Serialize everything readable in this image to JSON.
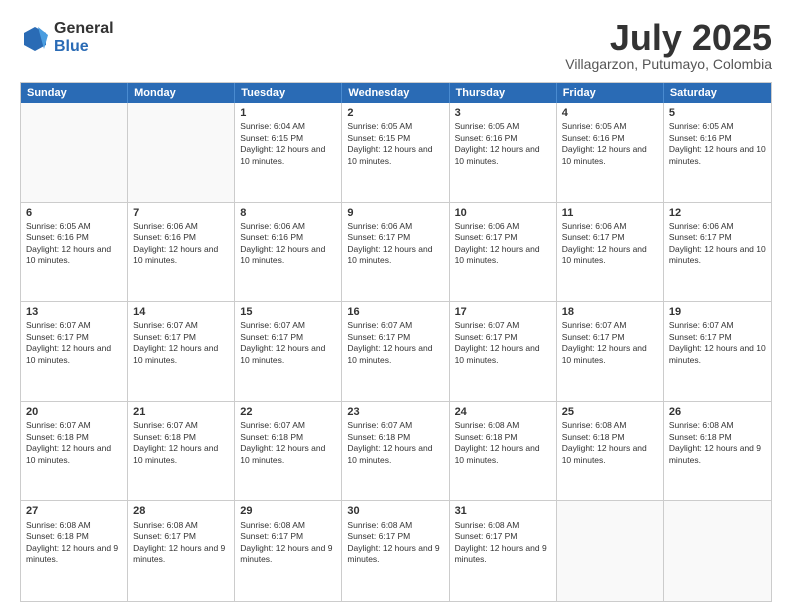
{
  "logo": {
    "general": "General",
    "blue": "Blue"
  },
  "title": {
    "month_year": "July 2025",
    "location": "Villagarzon, Putumayo, Colombia"
  },
  "weekdays": [
    "Sunday",
    "Monday",
    "Tuesday",
    "Wednesday",
    "Thursday",
    "Friday",
    "Saturday"
  ],
  "rows": [
    [
      {
        "day": "",
        "info": ""
      },
      {
        "day": "",
        "info": ""
      },
      {
        "day": "1",
        "info": "Sunrise: 6:04 AM\nSunset: 6:15 PM\nDaylight: 12 hours and 10 minutes."
      },
      {
        "day": "2",
        "info": "Sunrise: 6:05 AM\nSunset: 6:15 PM\nDaylight: 12 hours and 10 minutes."
      },
      {
        "day": "3",
        "info": "Sunrise: 6:05 AM\nSunset: 6:16 PM\nDaylight: 12 hours and 10 minutes."
      },
      {
        "day": "4",
        "info": "Sunrise: 6:05 AM\nSunset: 6:16 PM\nDaylight: 12 hours and 10 minutes."
      },
      {
        "day": "5",
        "info": "Sunrise: 6:05 AM\nSunset: 6:16 PM\nDaylight: 12 hours and 10 minutes."
      }
    ],
    [
      {
        "day": "6",
        "info": "Sunrise: 6:05 AM\nSunset: 6:16 PM\nDaylight: 12 hours and 10 minutes."
      },
      {
        "day": "7",
        "info": "Sunrise: 6:06 AM\nSunset: 6:16 PM\nDaylight: 12 hours and 10 minutes."
      },
      {
        "day": "8",
        "info": "Sunrise: 6:06 AM\nSunset: 6:16 PM\nDaylight: 12 hours and 10 minutes."
      },
      {
        "day": "9",
        "info": "Sunrise: 6:06 AM\nSunset: 6:17 PM\nDaylight: 12 hours and 10 minutes."
      },
      {
        "day": "10",
        "info": "Sunrise: 6:06 AM\nSunset: 6:17 PM\nDaylight: 12 hours and 10 minutes."
      },
      {
        "day": "11",
        "info": "Sunrise: 6:06 AM\nSunset: 6:17 PM\nDaylight: 12 hours and 10 minutes."
      },
      {
        "day": "12",
        "info": "Sunrise: 6:06 AM\nSunset: 6:17 PM\nDaylight: 12 hours and 10 minutes."
      }
    ],
    [
      {
        "day": "13",
        "info": "Sunrise: 6:07 AM\nSunset: 6:17 PM\nDaylight: 12 hours and 10 minutes."
      },
      {
        "day": "14",
        "info": "Sunrise: 6:07 AM\nSunset: 6:17 PM\nDaylight: 12 hours and 10 minutes."
      },
      {
        "day": "15",
        "info": "Sunrise: 6:07 AM\nSunset: 6:17 PM\nDaylight: 12 hours and 10 minutes."
      },
      {
        "day": "16",
        "info": "Sunrise: 6:07 AM\nSunset: 6:17 PM\nDaylight: 12 hours and 10 minutes."
      },
      {
        "day": "17",
        "info": "Sunrise: 6:07 AM\nSunset: 6:17 PM\nDaylight: 12 hours and 10 minutes."
      },
      {
        "day": "18",
        "info": "Sunrise: 6:07 AM\nSunset: 6:17 PM\nDaylight: 12 hours and 10 minutes."
      },
      {
        "day": "19",
        "info": "Sunrise: 6:07 AM\nSunset: 6:17 PM\nDaylight: 12 hours and 10 minutes."
      }
    ],
    [
      {
        "day": "20",
        "info": "Sunrise: 6:07 AM\nSunset: 6:18 PM\nDaylight: 12 hours and 10 minutes."
      },
      {
        "day": "21",
        "info": "Sunrise: 6:07 AM\nSunset: 6:18 PM\nDaylight: 12 hours and 10 minutes."
      },
      {
        "day": "22",
        "info": "Sunrise: 6:07 AM\nSunset: 6:18 PM\nDaylight: 12 hours and 10 minutes."
      },
      {
        "day": "23",
        "info": "Sunrise: 6:07 AM\nSunset: 6:18 PM\nDaylight: 12 hours and 10 minutes."
      },
      {
        "day": "24",
        "info": "Sunrise: 6:08 AM\nSunset: 6:18 PM\nDaylight: 12 hours and 10 minutes."
      },
      {
        "day": "25",
        "info": "Sunrise: 6:08 AM\nSunset: 6:18 PM\nDaylight: 12 hours and 10 minutes."
      },
      {
        "day": "26",
        "info": "Sunrise: 6:08 AM\nSunset: 6:18 PM\nDaylight: 12 hours and 9 minutes."
      }
    ],
    [
      {
        "day": "27",
        "info": "Sunrise: 6:08 AM\nSunset: 6:18 PM\nDaylight: 12 hours and 9 minutes."
      },
      {
        "day": "28",
        "info": "Sunrise: 6:08 AM\nSunset: 6:17 PM\nDaylight: 12 hours and 9 minutes."
      },
      {
        "day": "29",
        "info": "Sunrise: 6:08 AM\nSunset: 6:17 PM\nDaylight: 12 hours and 9 minutes."
      },
      {
        "day": "30",
        "info": "Sunrise: 6:08 AM\nSunset: 6:17 PM\nDaylight: 12 hours and 9 minutes."
      },
      {
        "day": "31",
        "info": "Sunrise: 6:08 AM\nSunset: 6:17 PM\nDaylight: 12 hours and 9 minutes."
      },
      {
        "day": "",
        "info": ""
      },
      {
        "day": "",
        "info": ""
      }
    ]
  ]
}
